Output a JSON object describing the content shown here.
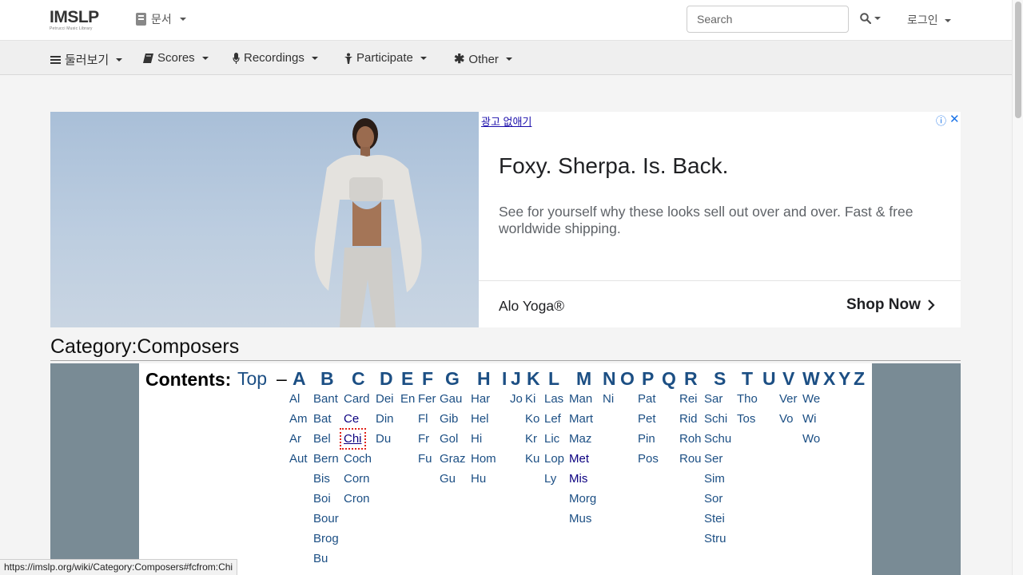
{
  "header": {
    "logo_text": "IMSLP",
    "logo_subtitle": "Petrucci Music Library",
    "doc_menu_label": "문서",
    "search_placeholder": "Search",
    "login_label": "로그인"
  },
  "nav": [
    {
      "label": "둘러보기",
      "icon": "bars-icon"
    },
    {
      "label": "Scores",
      "icon": "book-icon"
    },
    {
      "label": "Recordings",
      "icon": "microphone-icon"
    },
    {
      "label": "Participate",
      "icon": "person-icon"
    },
    {
      "label": "Other",
      "icon": "asterisk-icon"
    }
  ],
  "ad": {
    "no_ads_link": "광고 없애기",
    "headline": "Foxy. Sherpa. Is. Back.",
    "body": "See for yourself why these looks sell out over and over. Fast & free worldwide shipping.",
    "brand": "Alo Yoga®",
    "cta": "Shop Now"
  },
  "category": {
    "title": "Category:Composers"
  },
  "contents": {
    "label": "Contents:",
    "top_link": "Top",
    "separator": "–",
    "letters": [
      "A",
      "B",
      "C",
      "D",
      "E",
      "F",
      "G",
      "H",
      "I",
      "J",
      "K",
      "L",
      "M",
      "N",
      "O",
      "P",
      "Q",
      "R",
      "S",
      "T",
      "U",
      "V",
      "W",
      "X",
      "Y",
      "Z"
    ],
    "columns": [
      {
        "letter": "A",
        "items": [
          "Al",
          "Am",
          "Ar",
          "Aut"
        ]
      },
      {
        "letter": "B",
        "items": [
          "Bant",
          "Bat",
          "Bel",
          "Bern",
          "Bis",
          "Boi",
          "Bour",
          "Brog",
          "Bu"
        ]
      },
      {
        "letter": "C",
        "items": [
          "Card",
          "Ce",
          "Chi",
          "Coch",
          "Corn",
          "Cron"
        ]
      },
      {
        "letter": "D",
        "items": [
          "Dei",
          "Din",
          "Du"
        ]
      },
      {
        "letter": "E",
        "items": [
          "En"
        ]
      },
      {
        "letter": "F",
        "items": [
          "Fer",
          "Fl",
          "Fr",
          "Fu"
        ]
      },
      {
        "letter": "G",
        "items": [
          "Gau",
          "Gib",
          "Gol",
          "Graz",
          "Gu"
        ]
      },
      {
        "letter": "H",
        "items": [
          "Har",
          "Hel",
          "Hi",
          "Hom",
          "Hu"
        ]
      },
      {
        "letter": "J",
        "items": [
          "Jo"
        ]
      },
      {
        "letter": "K",
        "items": [
          "Ki",
          "Ko",
          "Kr",
          "Ku"
        ]
      },
      {
        "letter": "L",
        "items": [
          "Las",
          "Lef",
          "Lic",
          "Lop",
          "Ly"
        ]
      },
      {
        "letter": "M",
        "items": [
          "Man",
          "Mart",
          "Maz",
          "Met",
          "Mis",
          "Morg",
          "Mus"
        ]
      },
      {
        "letter": "N",
        "items": [
          "Ni"
        ]
      },
      {
        "letter": "P",
        "items": [
          "Pat",
          "Pet",
          "Pin",
          "Pos"
        ]
      },
      {
        "letter": "R",
        "items": [
          "Rei",
          "Rid",
          "Roh",
          "Rou"
        ]
      },
      {
        "letter": "S",
        "items": [
          "Sar",
          "Schi",
          "Schu",
          "Ser",
          "Sim",
          "Sor",
          "Stei",
          "Stru"
        ]
      },
      {
        "letter": "T",
        "items": [
          "Tho",
          "Tos"
        ]
      },
      {
        "letter": "V",
        "items": [
          "Ver",
          "Vo"
        ]
      },
      {
        "letter": "W",
        "items": [
          "We",
          "Wi",
          "Wo"
        ]
      }
    ],
    "focused_item": "Chi",
    "visited_items": [
      "Ce",
      "Chi",
      "Met",
      "Mis"
    ]
  },
  "status_url": "https://imslp.org/wiki/Category:Composers#fcfrom:Chi",
  "colors": {
    "link": "#1c4f84",
    "visited_link": "#0b0080",
    "contents_border": "#798b95",
    "focus_outline": "#e2231a"
  }
}
